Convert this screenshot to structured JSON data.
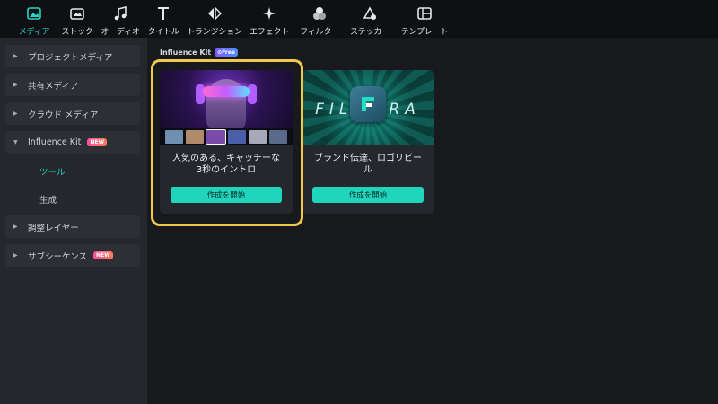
{
  "toolbar": {
    "items": [
      {
        "label": "メディア",
        "icon": "media-icon",
        "active": true
      },
      {
        "label": "ストック",
        "icon": "stock-icon"
      },
      {
        "label": "オーディオ",
        "icon": "audio-note-icon"
      },
      {
        "label": "タイトル",
        "icon": "title-t-icon"
      },
      {
        "label": "トランジション",
        "icon": "transition-icon"
      },
      {
        "label": "エフェクト",
        "icon": "effect-sparkle-icon"
      },
      {
        "label": "フィルター",
        "icon": "filter-circles-icon"
      },
      {
        "label": "ステッカー",
        "icon": "sticker-icon"
      },
      {
        "label": "テンプレート",
        "icon": "template-icon"
      }
    ]
  },
  "sidebar": {
    "items": [
      {
        "label": "プロジェクトメディア"
      },
      {
        "label": "共有メディア"
      },
      {
        "label": "クラウド メディア"
      },
      {
        "label": "Influence Kit",
        "badge": "NEW",
        "expanded": true
      },
      {
        "label": "調整レイヤー"
      },
      {
        "label": "サブシーケンス",
        "badge": "NEW"
      }
    ],
    "subitems": [
      {
        "label": "ツール",
        "active": true
      },
      {
        "label": "生成"
      }
    ]
  },
  "main": {
    "section_title": "Influence Kit",
    "section_badge": "⊙Free",
    "cards": [
      {
        "title_line1": "人気のある、キャッチーな",
        "title_line2": "3秒のイントロ",
        "button": "作成を開始",
        "highlighted": true
      },
      {
        "title_line1": "ブランド伝達、ロゴリビー",
        "title_line2": "ル",
        "button": "作成を開始",
        "thumb_text": "FILMORA"
      }
    ]
  },
  "colors": {
    "accent": "#27d6c4",
    "button": "#1fd6bd",
    "highlight": "#f1c84b"
  }
}
